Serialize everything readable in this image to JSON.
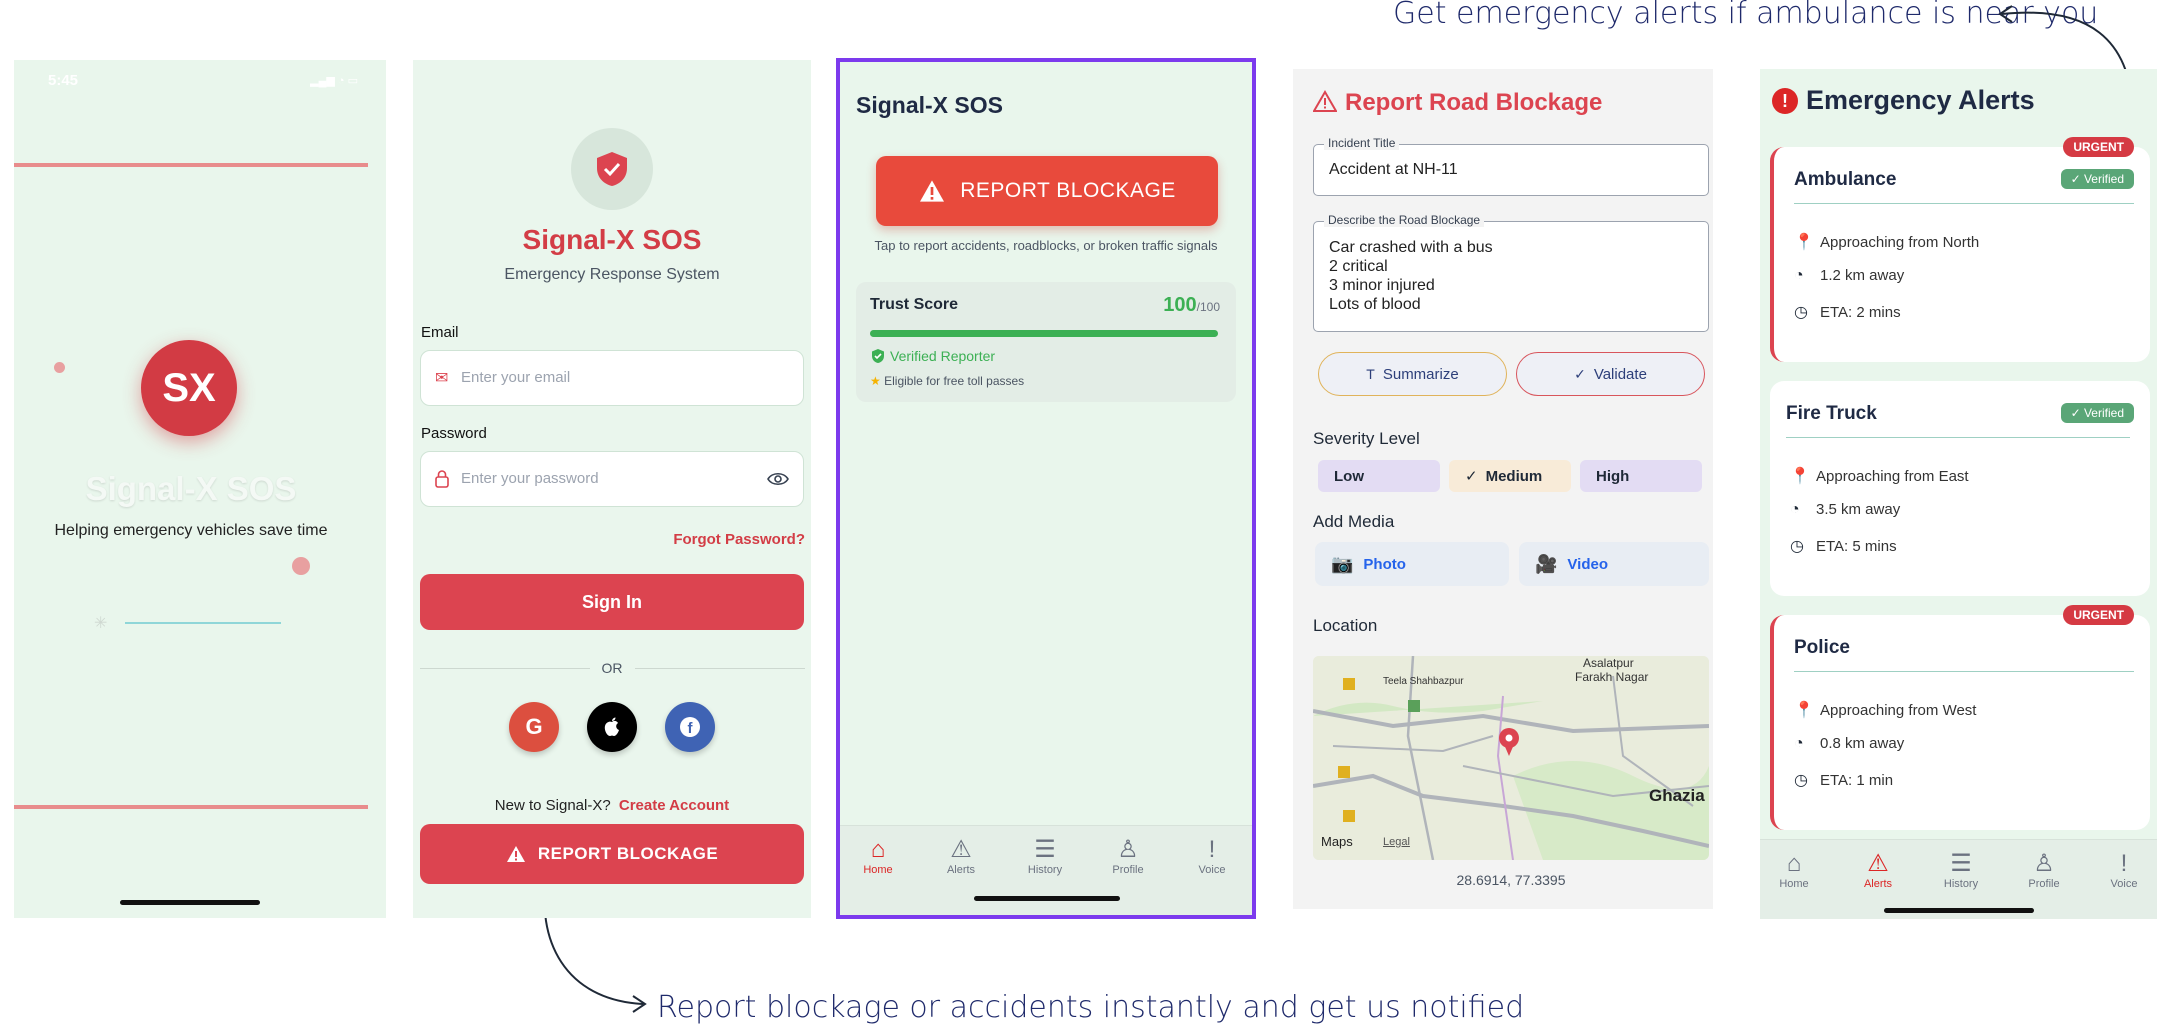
{
  "captions": {
    "top": "Get emergency alerts if ambulance is near you",
    "bottom": "Report blockage or accidents instantly and get us notified"
  },
  "splash": {
    "status_time": "5:45",
    "logo_text": "SX",
    "app_name": "Signal-X SOS",
    "tagline": "Helping emergency vehicles save time"
  },
  "login": {
    "app_name": "Signal-X SOS",
    "subtitle": "Emergency Response System",
    "email_label": "Email",
    "email_placeholder": "Enter your email",
    "password_label": "Password",
    "password_placeholder": "Enter your password",
    "forgot": "Forgot Password?",
    "sign_in": "Sign In",
    "or": "OR",
    "new_user": "New to Signal-X?",
    "create_account": "Create Account",
    "report_blockage": "REPORT BLOCKAGE"
  },
  "home": {
    "title": "Signal-X SOS",
    "report_button": "REPORT BLOCKAGE",
    "hint": "Tap to report accidents, roadblocks, or broken traffic signals",
    "trust_label": "Trust Score",
    "trust_value": "100",
    "trust_max": "/100",
    "trust_fraction": 1.0,
    "verified": "Verified Reporter",
    "eligible": "Eligible for free toll passes",
    "nav": [
      "Home",
      "Alerts",
      "History",
      "Profile",
      "Voice"
    ]
  },
  "report": {
    "title": "Report Road Blockage",
    "incident_label": "Incident Title",
    "incident_value": "Accident at NH-11",
    "describe_label": "Describe the Road Blockage",
    "describe_lines": [
      "Car crashed with a bus",
      "2 critical",
      "3 minor injured",
      "Lots of blood"
    ],
    "summarize": "Summarize",
    "validate": "Validate",
    "severity_label": "Severity Level",
    "severity": [
      "Low",
      "Medium",
      "High"
    ],
    "severity_selected": "Medium",
    "media_label": "Add Media",
    "photo": "Photo",
    "video": "Video",
    "location_label": "Location",
    "map_places": [
      "Asalatpur",
      "Farakh Nagar",
      "Teela Shahbazpur",
      "Ghazia"
    ],
    "map_brand": "Maps",
    "map_legal": "Legal",
    "coords": "28.6914, 77.3395"
  },
  "alerts": {
    "title": "Emergency Alerts",
    "items": [
      {
        "name": "Ambulance",
        "badge": "URGENT",
        "verified": "Verified",
        "from": "Approaching from North",
        "dist": "1.2 km away",
        "eta": "ETA: 2 mins"
      },
      {
        "name": "Fire Truck",
        "badge": "",
        "verified": "Verified",
        "from": "Approaching from East",
        "dist": "3.5 km away",
        "eta": "ETA: 5 mins"
      },
      {
        "name": "Police",
        "badge": "URGENT",
        "verified": "",
        "from": "Approaching from West",
        "dist": "0.8 km away",
        "eta": "ETA: 1 min"
      }
    ],
    "nav": [
      "Home",
      "Alerts",
      "History",
      "Profile",
      "Voice"
    ]
  },
  "colors": {
    "brand_red": "#dc4450",
    "accent_purple": "#7c3aed",
    "success_green": "#3cb054"
  }
}
